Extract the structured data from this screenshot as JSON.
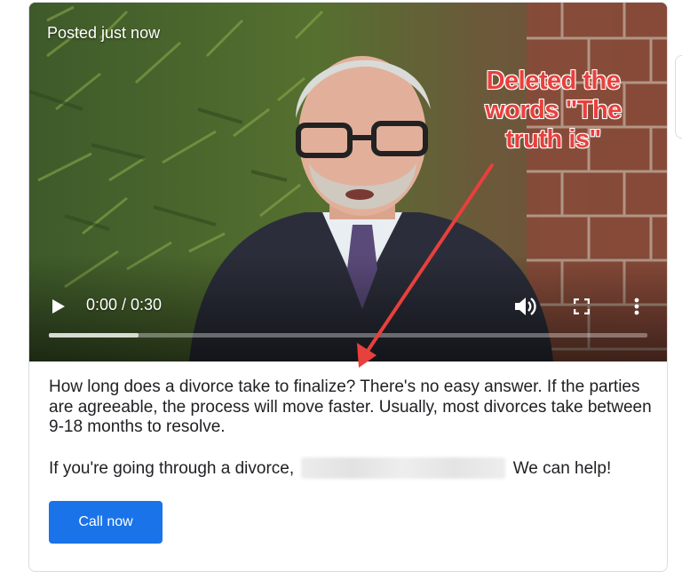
{
  "post": {
    "posted_label": "Posted just now",
    "video": {
      "current_time": "0:00",
      "duration": "0:30",
      "time_display": "0:00 / 0:30",
      "played_fraction": 0,
      "buffered_fraction": 0.15
    },
    "annotation": {
      "lines": [
        "Deleted the",
        "words \"The",
        "truth is\""
      ],
      "color": "#e8403c"
    },
    "description": "How long does a divorce take to finalize? There's no easy answer. If the parties are agreeable, the process will move faster. Usually, most divorces take between 9-18 months to resolve.",
    "cta_text_before": "If you're going through a divorce,",
    "cta_text_after": "We can help!",
    "button_label": "Call now"
  },
  "colors": {
    "button": "#1a73e8",
    "text": "#202124",
    "border": "#dadce0"
  },
  "icons": [
    "play-icon",
    "volume-icon",
    "fullscreen-icon",
    "more-vert-icon"
  ]
}
